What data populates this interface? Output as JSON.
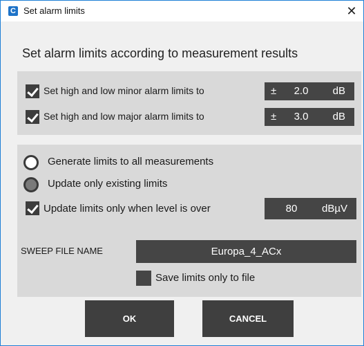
{
  "window": {
    "title": "Set alarm limits",
    "app_icon_letter": "C",
    "close_glyph": "✕"
  },
  "heading": "Set alarm limits according to measurement results",
  "minor": {
    "label": "Set high and low minor alarm limits to",
    "checked": true,
    "prefix": "±",
    "value": "2.0",
    "unit": "dB"
  },
  "major": {
    "label": "Set high and low major alarm limits to",
    "checked": true,
    "prefix": "±",
    "value": "3.0",
    "unit": "dB"
  },
  "radios": {
    "generate_all": {
      "label": "Generate limits to all measurements",
      "selected": false
    },
    "update_existing": {
      "label": "Update only existing limits",
      "selected": true
    }
  },
  "level": {
    "label": "Update limits only when level is over",
    "checked": true,
    "value": "80",
    "unit": "dBµV"
  },
  "sweep": {
    "label": "SWEEP FILE NAME",
    "value": "Europa_4_ACx"
  },
  "save_to_file": {
    "label": "Save limits only to file",
    "checked": false
  },
  "buttons": {
    "ok": "OK",
    "cancel": "CANCEL"
  },
  "colors": {
    "accent_border": "#1e7fd6",
    "panel": "#d9d9d9",
    "dark_control": "#454545"
  }
}
